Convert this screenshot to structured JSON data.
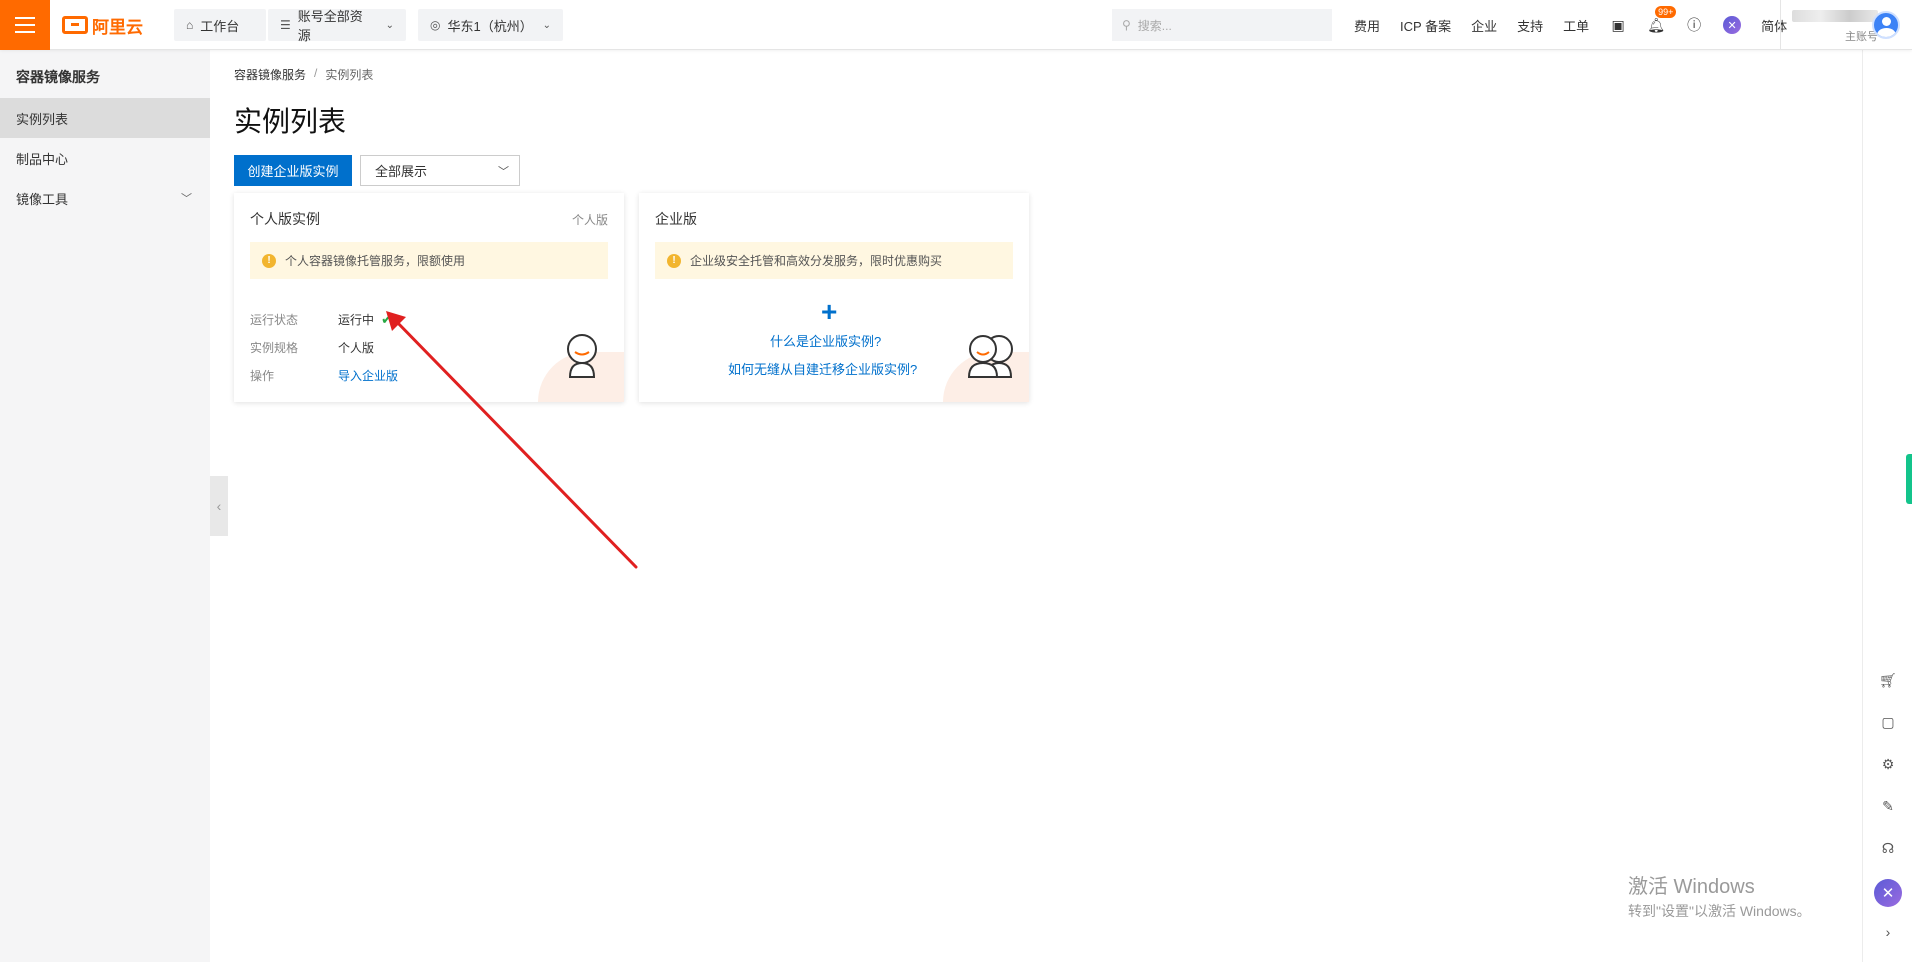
{
  "topbar": {
    "brand": "阿里云",
    "workbench": "工作台",
    "resources": "账号全部资源",
    "region": "华东1（杭州）",
    "search_placeholder": "搜索...",
    "links": [
      "费用",
      "ICP 备案",
      "企业",
      "支持",
      "工单"
    ],
    "notification_badge": "99+",
    "language": "简体",
    "account_type": "主账号"
  },
  "sidebar": {
    "title": "容器镜像服务",
    "items": [
      {
        "label": "实例列表",
        "active": true
      },
      {
        "label": "制品中心",
        "active": false
      },
      {
        "label": "镜像工具",
        "active": false,
        "expandable": true
      }
    ]
  },
  "breadcrumb": {
    "root": "容器镜像服务",
    "sep": "/",
    "current": "实例列表"
  },
  "page": {
    "title": "实例列表",
    "create_button": "创建企业版实例",
    "filter_value": "全部展示"
  },
  "cards": {
    "personal": {
      "title": "个人版实例",
      "tag": "个人版",
      "notice": "个人容器镜像托管服务，限额使用",
      "fields": [
        {
          "key": "运行状态",
          "value": "运行中"
        },
        {
          "key": "实例规格",
          "value": "个人版"
        },
        {
          "key": "操作",
          "value": "导入企业版"
        }
      ]
    },
    "enterprise": {
      "title": "企业版",
      "notice": "企业级安全托管和高效分发服务，限时优惠购买",
      "link1": "什么是企业版实例?",
      "link2": "如何无缝从自建迁移企业版实例?"
    }
  },
  "watermark": {
    "line1": "激活 Windows",
    "line2": "转到\"设置\"以激活 Windows。"
  },
  "colors": {
    "brand": "#ff6a00",
    "primary": "#0070cc",
    "success": "#27a844",
    "annotation": "#e02020"
  },
  "icons": [
    "menu-icon",
    "home-icon",
    "resource-icon",
    "location-icon",
    "search-icon",
    "terminal-icon",
    "bell-icon",
    "help-icon",
    "app-icon",
    "cart-icon",
    "settings-icon",
    "edit-icon",
    "headset-icon"
  ]
}
